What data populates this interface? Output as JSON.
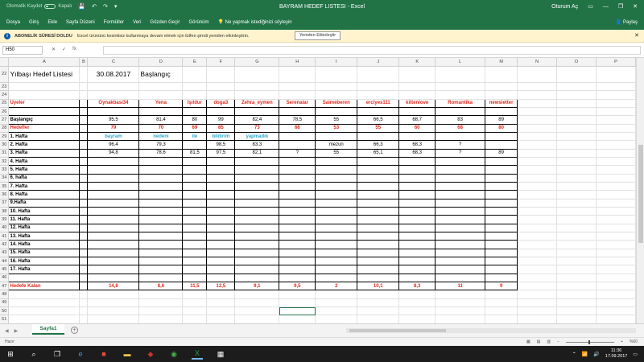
{
  "titlebar": {
    "autosave_label": "Otomatik Kaydet",
    "autosave_state": "Kapalı",
    "title": "BAYRAM HEDEF LISTESI  -  Excel",
    "account": "Oturum Aç"
  },
  "ribbon": {
    "tabs": [
      "Dosya",
      "Giriş",
      "Ekle",
      "Sayfa Düzeni",
      "Formüller",
      "Veri",
      "Gözden Geçir",
      "Görünüm"
    ],
    "tell_me": "Ne yapmak istediğinizi söyleyin",
    "share": "Paylaş"
  },
  "message_bar": {
    "label": "ABONELİK SÜRESİ DOLDU",
    "text": "Excel ürününü kesintisiz kullanmaya devam etmek için lütfen şimdi yeniden etkinleştirin.",
    "button": "Yeniden Etkinleştir"
  },
  "formula_bar": {
    "name_box": "H50",
    "formula": ""
  },
  "columns": [
    "A",
    "B",
    "C",
    "D",
    "E",
    "F",
    "G",
    "H",
    "I",
    "J",
    "K",
    "L",
    "M",
    "N",
    "O",
    "P"
  ],
  "rows": [
    {
      "n": "22",
      "tall": true,
      "cells": [
        "Yılbaşı Hedef Listesi",
        "",
        "30.08.2017",
        "Başlangıç",
        "",
        "",
        "",
        "",
        "",
        "",
        "",
        "",
        "",
        "",
        "",
        ""
      ]
    },
    {
      "n": "23",
      "cells": [
        "",
        "",
        "",
        "",
        "",
        "",
        "",
        "",
        "",
        "",
        "",
        "",
        "",
        "",
        "",
        ""
      ]
    },
    {
      "n": "24",
      "cells": [
        "",
        "",
        "",
        "",
        "",
        "",
        "",
        "",
        "",
        "",
        "",
        "",
        "",
        "",
        "",
        ""
      ]
    },
    {
      "n": "25",
      "cells": [
        "Üyeler",
        "",
        "Oynakbasi34",
        "Yena",
        "Işıldur",
        "doga3",
        "Zehra_eymen",
        "Serenalar",
        "Saimeberen",
        "erciyes111",
        "kittenlove",
        "Romantika",
        "newsletter",
        "",
        "",
        ""
      ]
    },
    {
      "n": "26",
      "cells": [
        "",
        "",
        "",
        "",
        "",
        "",
        "",
        "",
        "",
        "",
        "",
        "",
        "",
        "",
        "",
        ""
      ]
    },
    {
      "n": "27",
      "cells": [
        "Başlangıç",
        "",
        "95,5",
        "81,4",
        "80",
        "99",
        "82,4",
        "78,5",
        "55",
        "66,5",
        "68,7",
        "83",
        "89",
        "",
        "",
        ""
      ]
    },
    {
      "n": "28",
      "cells": [
        "Hedefler",
        "",
        "79",
        "70",
        "69",
        "85",
        "73",
        "68",
        "53",
        "55",
        "60",
        "68",
        "80",
        "",
        "",
        ""
      ]
    },
    {
      "n": "29",
      "cells": [
        "1. Hafta",
        "",
        "bayram",
        "nedeni",
        "ile",
        "bildirim",
        "yapmadık",
        "",
        "",
        "",
        "",
        "",
        "",
        "",
        "",
        ""
      ]
    },
    {
      "n": "30",
      "cells": [
        "2. Hafta",
        "",
        "96,4",
        "79,3",
        "",
        "98,5",
        "83,3",
        "",
        "mezun",
        "66,3",
        "68,3",
        "?",
        "",
        "",
        "",
        ""
      ]
    },
    {
      "n": "31",
      "cells": [
        "3. Hafta",
        "",
        "94,8",
        "78,6",
        "81,5",
        "97,5",
        "82,1",
        "?",
        "55",
        "65,1",
        "68,3",
        "?",
        "89",
        "",
        "",
        ""
      ]
    },
    {
      "n": "32",
      "cells": [
        "4. Hafta",
        "",
        "",
        "",
        "",
        "",
        "",
        "",
        "",
        "",
        "",
        "",
        "",
        "",
        "",
        ""
      ]
    },
    {
      "n": "33",
      "cells": [
        "5. Hafta",
        "",
        "",
        "",
        "",
        "",
        "",
        "",
        "",
        "",
        "",
        "",
        "",
        "",
        "",
        ""
      ]
    },
    {
      "n": "34",
      "cells": [
        "6. hafta",
        "",
        "",
        "",
        "",
        "",
        "",
        "",
        "",
        "",
        "",
        "",
        "",
        "",
        "",
        ""
      ]
    },
    {
      "n": "35",
      "cells": [
        "7. Hafta",
        "",
        "",
        "",
        "",
        "",
        "",
        "",
        "",
        "",
        "",
        "",
        "",
        "",
        "",
        ""
      ]
    },
    {
      "n": "36",
      "cells": [
        "8. Hafta",
        "",
        "",
        "",
        "",
        "",
        "",
        "",
        "",
        "",
        "",
        "",
        "",
        "",
        "",
        ""
      ]
    },
    {
      "n": "37",
      "cells": [
        "9.Hafta",
        "",
        "",
        "",
        "",
        "",
        "",
        "",
        "",
        "",
        "",
        "",
        "",
        "",
        "",
        ""
      ]
    },
    {
      "n": "38",
      "cells": [
        "10. Hafta",
        "",
        "",
        "",
        "",
        "",
        "",
        "",
        "",
        "",
        "",
        "",
        "",
        "",
        "",
        ""
      ]
    },
    {
      "n": "39",
      "cells": [
        "11. Hafta",
        "",
        "",
        "",
        "",
        "",
        "",
        "",
        "",
        "",
        "",
        "",
        "",
        "",
        "",
        ""
      ]
    },
    {
      "n": "40",
      "cells": [
        "12. Hafta",
        "",
        "",
        "",
        "",
        "",
        "",
        "",
        "",
        "",
        "",
        "",
        "",
        "",
        "",
        ""
      ]
    },
    {
      "n": "41",
      "cells": [
        "13. Hafta",
        "",
        "",
        "",
        "",
        "",
        "",
        "",
        "",
        "",
        "",
        "",
        "",
        "",
        "",
        ""
      ]
    },
    {
      "n": "42",
      "cells": [
        "14. Hafta",
        "",
        "",
        "",
        "",
        "",
        "",
        "",
        "",
        "",
        "",
        "",
        "",
        "",
        "",
        ""
      ]
    },
    {
      "n": "43",
      "cells": [
        "15. Hafta",
        "",
        "",
        "",
        "",
        "",
        "",
        "",
        "",
        "",
        "",
        "",
        "",
        "",
        "",
        ""
      ]
    },
    {
      "n": "44",
      "cells": [
        "16. Hafta",
        "",
        "",
        "",
        "",
        "",
        "",
        "",
        "",
        "",
        "",
        "",
        "",
        "",
        "",
        ""
      ]
    },
    {
      "n": "45",
      "cells": [
        "17. Hafta",
        "",
        "",
        "",
        "",
        "",
        "",
        "",
        "",
        "",
        "",
        "",
        "",
        "",
        "",
        ""
      ]
    },
    {
      "n": "46",
      "cells": [
        "",
        "",
        "",
        "",
        "",
        "",
        "",
        "",
        "",
        "",
        "",
        "",
        "",
        "",
        "",
        ""
      ]
    },
    {
      "n": "47",
      "cells": [
        "Hedefe Kalan",
        "",
        "14,8",
        "8,6",
        "11,5",
        "12,5",
        "9,1",
        "9,5",
        "2",
        "10,1",
        "8,3",
        "11",
        "9",
        "",
        "",
        ""
      ]
    },
    {
      "n": "48",
      "cells": [
        "",
        "",
        "",
        "",
        "",
        "",
        "",
        "",
        "",
        "",
        "",
        "",
        "",
        "",
        "",
        ""
      ]
    },
    {
      "n": "49",
      "cells": [
        "",
        "",
        "",
        "",
        "",
        "",
        "",
        "",
        "",
        "",
        "",
        "",
        "",
        "",
        "",
        ""
      ]
    },
    {
      "n": "50",
      "cells": [
        "",
        "",
        "",
        "",
        "",
        "",
        "",
        "",
        "",
        "",
        "",
        "",
        "",
        "",
        "",
        ""
      ]
    },
    {
      "n": "51",
      "cells": [
        "",
        "",
        "",
        "",
        "",
        "",
        "",
        "",
        "",
        "",
        "",
        "",
        "",
        "",
        "",
        ""
      ]
    },
    {
      "n": "52",
      "cells": [
        "",
        "",
        "",
        "",
        "",
        "",
        "",
        "",
        "",
        "",
        "",
        "",
        "",
        "",
        "",
        ""
      ]
    }
  ],
  "sheets": [
    "Sayfa1"
  ],
  "status": {
    "ready": "Hazır",
    "zoom": "%60"
  },
  "taskbar": {
    "time": "11:36",
    "date": "17.09.2017"
  },
  "colors": {
    "excel_green": "#217346",
    "red_text": "#e0271d",
    "blue_text": "#2aa7c9"
  }
}
